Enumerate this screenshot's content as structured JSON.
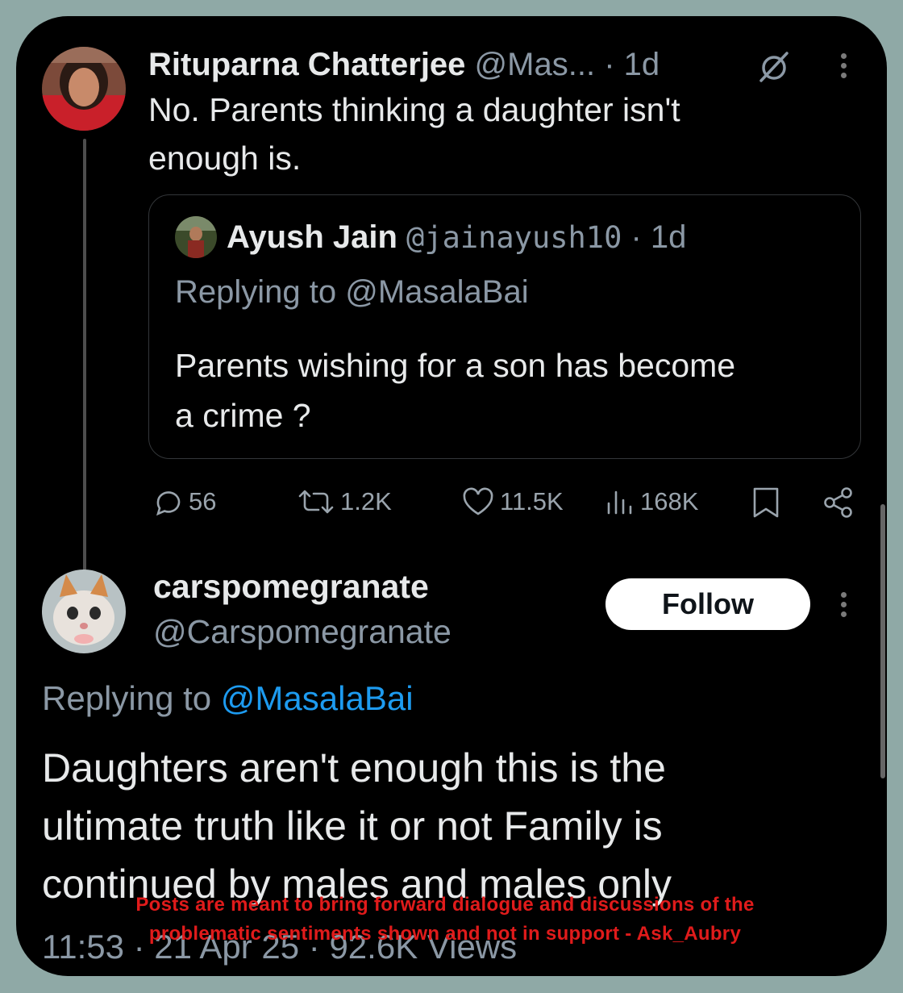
{
  "post1": {
    "display_name": "Rituparna Chatterjee",
    "handle": "@Mas...",
    "time": "· 1d",
    "text_line1": "No. Parents thinking a daughter isn't",
    "text_line2": "enough is."
  },
  "quote": {
    "display_name": "Ayush Jain",
    "handle": "@jainayush10",
    "time": "· 1d",
    "replying_to": "Replying to @MasalaBai",
    "text_line1": "Parents wishing for a son has become",
    "text_line2": "a crime ?"
  },
  "actions": {
    "replies": "56",
    "reposts": "1.2K",
    "likes": "11.5K",
    "views": "168K"
  },
  "post2": {
    "display_name": "carspomegranate",
    "handle": "@Carspomegranate",
    "follow_label": "Follow",
    "replying_prefix": "Replying to",
    "replying_handle": "@MasalaBai",
    "text_line1": "Daughters aren't enough this is the",
    "text_line2": "ultimate truth like it or not Family is",
    "text_line3": "continued by males and males only",
    "meta": "11:53 · 21 Apr 25 · 92.6K Views"
  },
  "watermark": {
    "line1": "Posts are meant to bring forward dialogue and discussions of the",
    "line2": "problematic sentiments shown and not in support - Ask_Aubry"
  },
  "colors": {
    "background": "#8fa9a6",
    "card": "#000000",
    "link": "#1d9bf0",
    "watermark": "#e01b1b"
  },
  "icons": [
    "grok-icon",
    "more-icon",
    "reply-icon",
    "repost-icon",
    "like-icon",
    "views-icon",
    "bookmark-icon",
    "share-icon"
  ]
}
